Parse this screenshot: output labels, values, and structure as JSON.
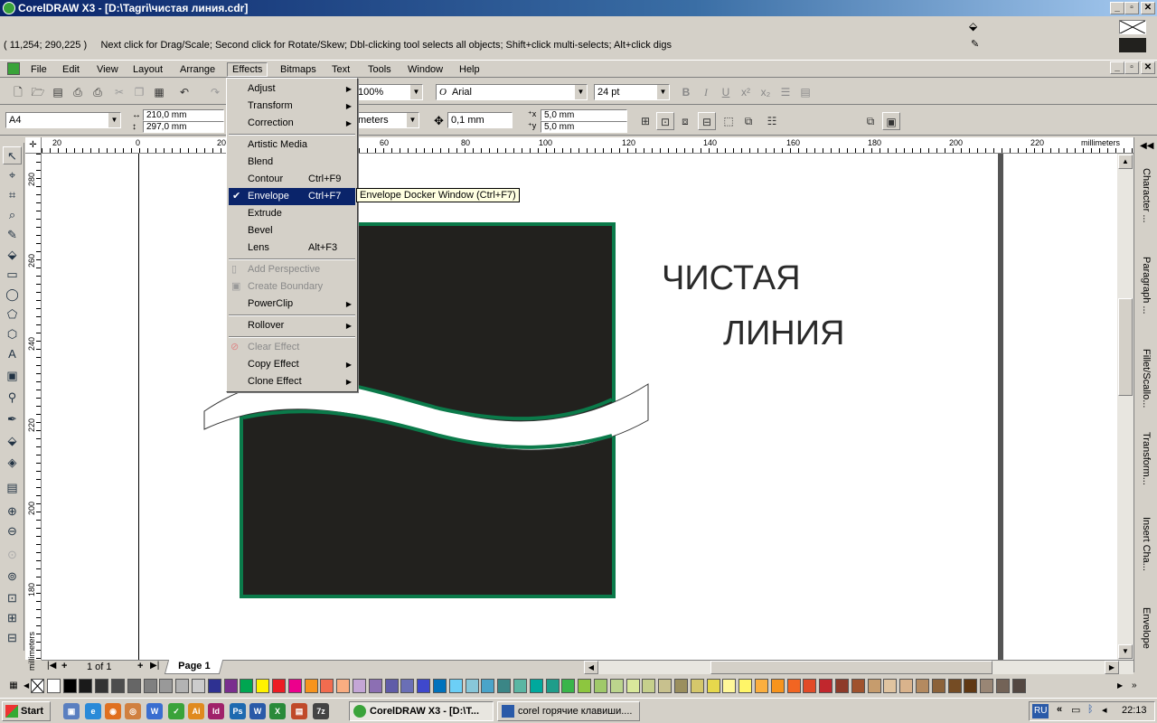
{
  "window": {
    "title": "CorelDRAW X3 - [D:\\Tagri\\чистая линия.cdr]"
  },
  "status": {
    "coords": "( 11,254; 290,225 )",
    "hint": "Next click for Drag/Scale; Second click for Rotate/Skew; Dbl-clicking tool selects all objects; Shift+click multi-selects; Alt+click digs"
  },
  "menubar": [
    "File",
    "Edit",
    "View",
    "Layout",
    "Arrange",
    "Effects",
    "Bitmaps",
    "Text",
    "Tools",
    "Window",
    "Help"
  ],
  "toolbar": {
    "zoom": "100%",
    "font_name": "Arial",
    "font_size": "24 pt"
  },
  "property_bar": {
    "paper": "A4",
    "width": "210,0 mm",
    "height": "297,0 mm",
    "units": "meters",
    "nudge": "0,1 mm",
    "dup_x": "5,0 mm",
    "dup_y": "5,0 mm"
  },
  "effects_menu": {
    "items": [
      {
        "label": "Adjust",
        "submenu": true
      },
      {
        "label": "Transform",
        "submenu": true
      },
      {
        "label": "Correction",
        "submenu": true
      },
      {
        "label": "Artistic Media"
      },
      {
        "label": "Blend"
      },
      {
        "label": "Contour",
        "shortcut": "Ctrl+F9"
      },
      {
        "label": "Envelope",
        "shortcut": "Ctrl+F7",
        "checked": true,
        "selected": true
      },
      {
        "label": "Extrude"
      },
      {
        "label": "Bevel"
      },
      {
        "label": "Lens",
        "shortcut": "Alt+F3"
      },
      {
        "label": "Add Perspective",
        "disabled": true
      },
      {
        "label": "Create Boundary",
        "disabled": true
      },
      {
        "label": "PowerClip",
        "submenu": true
      },
      {
        "label": "Rollover",
        "submenu": true
      },
      {
        "label": "Clear Effect",
        "disabled": true
      },
      {
        "label": "Copy Effect",
        "submenu": true
      },
      {
        "label": "Clone Effect",
        "submenu": true
      }
    ],
    "tooltip": "Envelope Docker Window (Ctrl+F7)"
  },
  "rulers": {
    "unit": "millimeters",
    "h_ticks": [
      "20",
      "0",
      "20",
      "40",
      "60",
      "80",
      "100",
      "120",
      "140",
      "160",
      "180",
      "200",
      "220"
    ],
    "v_ticks": [
      "280",
      "260",
      "240",
      "220",
      "200",
      "180"
    ],
    "v_unit": "millimeters"
  },
  "document": {
    "text_line1": "ЧИСТАЯ",
    "text_line2": "ЛИНИЯ",
    "colors": {
      "fill": "#22211e",
      "outline": "#0b7a4a"
    }
  },
  "dockers": [
    "Character ...",
    "Paragraph ...",
    "Fillet/Scallo...",
    "Transform...",
    "Insert Cha...",
    "Envelope"
  ],
  "page_nav": {
    "counter": "1 of 1",
    "tab": "Page 1"
  },
  "palette": [
    "#ffffff",
    "#000000",
    "#1a1a1a",
    "#333333",
    "#4d4d4d",
    "#666666",
    "#808080",
    "#999999",
    "#b3b3b3",
    "#cccccc",
    "#2e3192",
    "#7a2e8e",
    "#00a651",
    "#fff200",
    "#ed1c24",
    "#ec008c",
    "#f7941d",
    "#f26c4f",
    "#f9ad81",
    "#c4a6d6",
    "#8c6fb3",
    "#605ca8",
    "#6a6fb6",
    "#3f48cc",
    "#0072bc",
    "#6ccff6",
    "#88c7d9",
    "#4aa4c9",
    "#3b8686",
    "#5bb6a3",
    "#00a99d",
    "#1f9d8a",
    "#39b54a",
    "#8dc63f",
    "#a0c96a",
    "#bcd58d",
    "#d9e89b",
    "#c6d08c",
    "#c8c18e",
    "#9b8f5e",
    "#d5c76b",
    "#e6d84c",
    "#fff799",
    "#fff568",
    "#fbaf3f",
    "#f7941d",
    "#f26522",
    "#e24b28",
    "#c1272d",
    "#8e3b2a",
    "#a0522d",
    "#c69c6d",
    "#e0c4a0",
    "#d9b38c",
    "#b48a60",
    "#8c6239",
    "#754c24",
    "#603813",
    "#998675",
    "#736357",
    "#534741"
  ],
  "taskbar": {
    "start": "Start",
    "tasks": [
      "CorelDRAW X3 - [D:\\T...",
      "corel горячие клавиши...."
    ],
    "lang": "RU",
    "clock": "22:13"
  }
}
